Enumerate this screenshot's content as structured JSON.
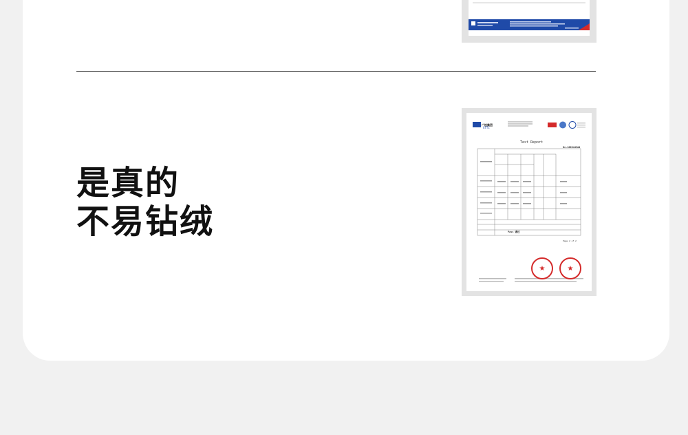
{
  "headline": {
    "line1": "是真的",
    "line2": "不易钻绒"
  },
  "report_preview": {
    "org_name": "广检集团",
    "org_code": "GTTC",
    "title": "Test Report",
    "number": "No.1000443A4",
    "page": "Page 2 of 2",
    "conclusion": "Pass 通过",
    "star_glyph": "★"
  },
  "colors": {
    "page_bg": "#f1f1f1",
    "card_bg": "#ffffff",
    "stamp_red": "#d42a2a",
    "brand_blue": "#1f4aa8"
  }
}
